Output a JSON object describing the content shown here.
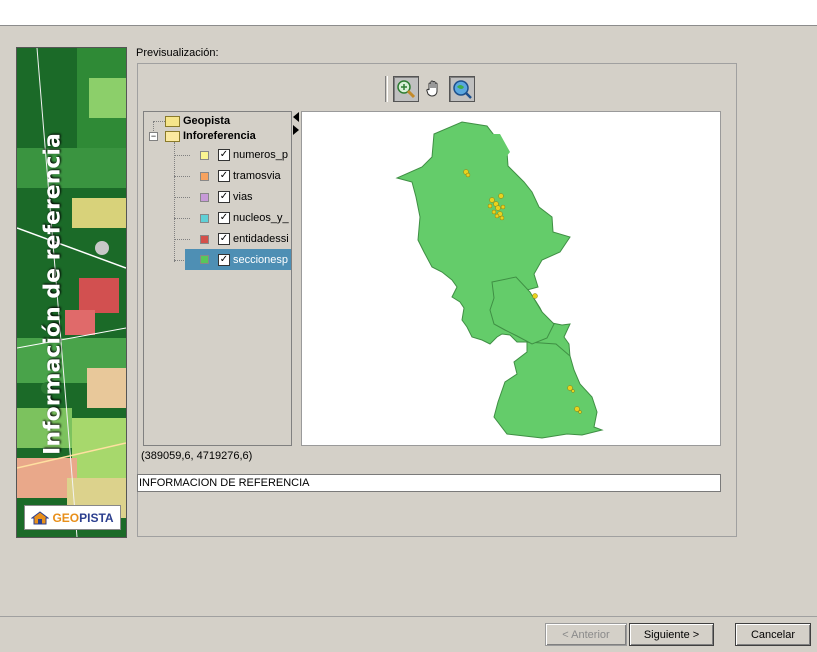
{
  "sidebar": {
    "title": "Información de referencia",
    "logo_geo": "GEO",
    "logo_pista": "PISTA"
  },
  "preview": {
    "label": "Previsualización:",
    "toolbar": [
      {
        "name": "zoom-in-icon",
        "active": true
      },
      {
        "name": "pan-hand-icon",
        "active": false
      },
      {
        "name": "zoom-extent-icon",
        "active": false
      }
    ]
  },
  "tree": {
    "root": "Geopista",
    "group": "Inforeferencia",
    "layers": [
      {
        "label": "numeros_p",
        "color": "#fbf592",
        "checked": true,
        "selected": false
      },
      {
        "label": "tramosvia",
        "color": "#f7a25e",
        "checked": true,
        "selected": false
      },
      {
        "label": "vias",
        "color": "#c79ad8",
        "checked": true,
        "selected": false
      },
      {
        "label": "nucleos_y_",
        "color": "#5fd0d6",
        "checked": true,
        "selected": false
      },
      {
        "label": "entidadessi",
        "color": "#d4504a",
        "checked": true,
        "selected": false
      },
      {
        "label": "seccionesp",
        "color": "#58c75a",
        "checked": true,
        "selected": true
      }
    ]
  },
  "map": {
    "fill_color": "#64cc6a",
    "point_color": "#e8d21e"
  },
  "status": {
    "coordinates": "(389059,6, 4719276,6)"
  },
  "name_field": {
    "value": "INFORMACION DE REFERENCIA"
  },
  "buttons": {
    "previous": "< Anterior",
    "next": "Siguiente >",
    "cancel": "Cancelar"
  }
}
